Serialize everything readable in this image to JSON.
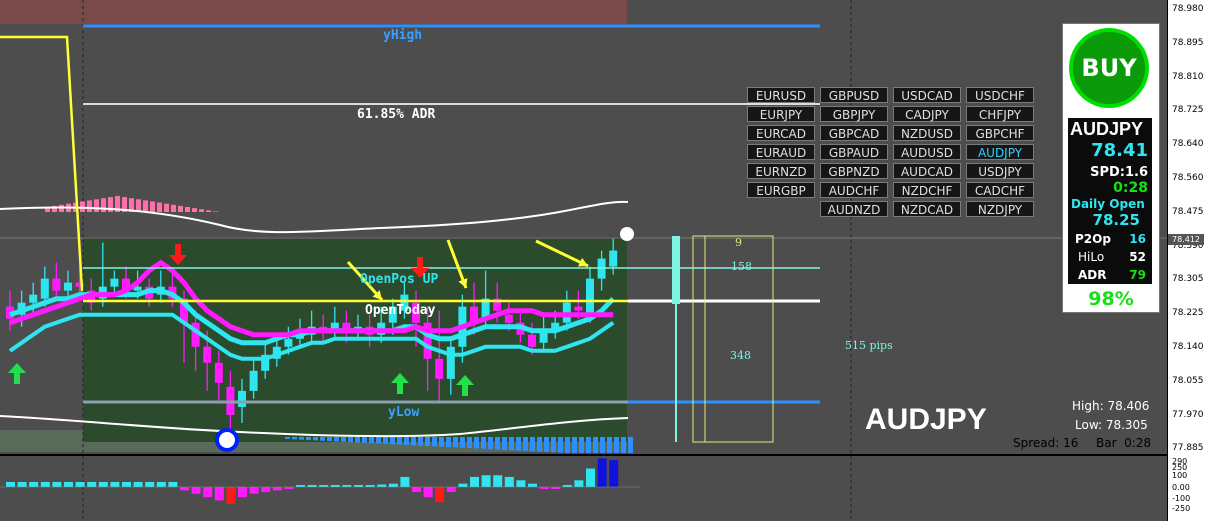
{
  "symbol": "AUDJPY",
  "chart_labels": {
    "y_high": "yHigh",
    "y_low": "yLow",
    "adr_line": "61.85% ADR",
    "open_pos": "OpenPos UP",
    "open_today": "OpenToday",
    "range_top": "9",
    "range_mid": "158",
    "range_bot": "348",
    "range_pips": "515 pips"
  },
  "price_axis": {
    "ticks": [
      "78.980",
      "78.895",
      "78.810",
      "78.725",
      "78.640",
      "78.560",
      "78.475",
      "78.390",
      "78.305",
      "78.225",
      "78.140",
      "78.055",
      "77.970",
      "77.885"
    ],
    "current_price": "78.412"
  },
  "indicator_axis": {
    "ticks": [
      "290",
      "250",
      "100",
      "0.00",
      "-100",
      "-250"
    ]
  },
  "pairs": [
    [
      "EURUSD",
      "GBPUSD",
      "USDCAD",
      "USDCHF"
    ],
    [
      "EURJPY",
      "GBPJPY",
      "CADJPY",
      "CHFJPY"
    ],
    [
      "EURCAD",
      "GBPCAD",
      "NZDUSD",
      "GBPCHF"
    ],
    [
      "EURAUD",
      "GBPAUD",
      "AUDUSD",
      "AUDJPY"
    ],
    [
      "EURNZD",
      "GBPNZD",
      "AUDCAD",
      "USDJPY"
    ],
    [
      "EURGBP",
      "AUDCHF",
      "NZDCHF",
      "CADCHF"
    ],
    [
      "",
      "AUDNZD",
      "NZDCAD",
      "NZDJPY"
    ]
  ],
  "active_pair": "AUDJPY",
  "panel": {
    "signal": "BUY",
    "symbol": "AUDJPY",
    "price": "78.41",
    "spread": "SPD:1.6",
    "timer": "0:28",
    "daily_open_label": "Daily Open",
    "daily_open": "78.25",
    "p2op_label": "P2Op",
    "p2op": "16",
    "hilo_label": "HiLo",
    "hilo": "52",
    "adr_label": "ADR",
    "adr": "79",
    "percent": "98%"
  },
  "bottom_info": {
    "symbol": "AUDJPY",
    "high": "High: 78.406",
    "low": "Low: 78.305",
    "spread": "Spread: 16",
    "bar": "Bar  0:28"
  },
  "colors": {
    "bull": "#2fe6f0",
    "bear": "#ff1aff",
    "green_arrow": "#22e04a",
    "red_arrow": "#ff1a1a",
    "yellow": "#ffff33",
    "blue_line": "#2f8fff",
    "pink_hist": "#ff6fa8",
    "range_box": "#2a4a2a"
  },
  "chart_data": {
    "type": "candlestick",
    "candles": [
      {
        "o": 78.24,
        "c": 78.21,
        "h": 78.28,
        "l": 78.18
      },
      {
        "o": 78.22,
        "c": 78.25,
        "h": 78.28,
        "l": 78.19
      },
      {
        "o": 78.25,
        "c": 78.27,
        "h": 78.3,
        "l": 78.22
      },
      {
        "o": 78.26,
        "c": 78.31,
        "h": 78.34,
        "l": 78.24
      },
      {
        "o": 78.31,
        "c": 78.28,
        "h": 78.35,
        "l": 78.26
      },
      {
        "o": 78.28,
        "c": 78.3,
        "h": 78.33,
        "l": 78.26
      },
      {
        "o": 78.3,
        "c": 78.29,
        "h": 78.34,
        "l": 78.27
      },
      {
        "o": 78.28,
        "c": 78.25,
        "h": 78.31,
        "l": 78.23
      },
      {
        "o": 78.26,
        "c": 78.29,
        "h": 78.4,
        "l": 78.24
      },
      {
        "o": 78.29,
        "c": 78.31,
        "h": 78.33,
        "l": 78.27
      },
      {
        "o": 78.31,
        "c": 78.28,
        "h": 78.34,
        "l": 78.26
      },
      {
        "o": 78.28,
        "c": 78.29,
        "h": 78.33,
        "l": 78.26
      },
      {
        "o": 78.29,
        "c": 78.26,
        "h": 78.31,
        "l": 78.24
      },
      {
        "o": 78.27,
        "c": 78.29,
        "h": 78.33,
        "l": 78.25
      },
      {
        "o": 78.29,
        "c": 78.26,
        "h": 78.33,
        "l": 78.24
      },
      {
        "o": 78.26,
        "c": 78.2,
        "h": 78.28,
        "l": 78.1
      },
      {
        "o": 78.2,
        "c": 78.14,
        "h": 78.23,
        "l": 78.08
      },
      {
        "o": 78.14,
        "c": 78.1,
        "h": 78.18,
        "l": 78.03
      },
      {
        "o": 78.1,
        "c": 78.05,
        "h": 78.13,
        "l": 78.0
      },
      {
        "o": 78.04,
        "c": 77.97,
        "h": 78.08,
        "l": 77.92
      },
      {
        "o": 77.99,
        "c": 78.03,
        "h": 78.06,
        "l": 77.95
      },
      {
        "o": 78.03,
        "c": 78.08,
        "h": 78.11,
        "l": 78.01
      },
      {
        "o": 78.08,
        "c": 78.12,
        "h": 78.15,
        "l": 78.06
      },
      {
        "o": 78.11,
        "c": 78.14,
        "h": 78.17,
        "l": 78.09
      },
      {
        "o": 78.14,
        "c": 78.16,
        "h": 78.19,
        "l": 78.12
      },
      {
        "o": 78.16,
        "c": 78.18,
        "h": 78.21,
        "l": 78.14
      },
      {
        "o": 78.17,
        "c": 78.19,
        "h": 78.23,
        "l": 78.15
      },
      {
        "o": 78.19,
        "c": 78.18,
        "h": 78.22,
        "l": 78.15
      },
      {
        "o": 78.18,
        "c": 78.2,
        "h": 78.24,
        "l": 78.16
      },
      {
        "o": 78.2,
        "c": 78.18,
        "h": 78.23,
        "l": 78.15
      },
      {
        "o": 78.18,
        "c": 78.19,
        "h": 78.22,
        "l": 78.16
      },
      {
        "o": 78.19,
        "c": 78.17,
        "h": 78.22,
        "l": 78.14
      },
      {
        "o": 78.17,
        "c": 78.2,
        "h": 78.24,
        "l": 78.15
      },
      {
        "o": 78.2,
        "c": 78.24,
        "h": 78.26,
        "l": 78.17
      },
      {
        "o": 78.23,
        "c": 78.27,
        "h": 78.3,
        "l": 78.21
      },
      {
        "o": 78.25,
        "c": 78.2,
        "h": 78.28,
        "l": 78.14
      },
      {
        "o": 78.2,
        "c": 78.11,
        "h": 78.24,
        "l": 78.03
      },
      {
        "o": 78.11,
        "c": 78.06,
        "h": 78.23,
        "l": 78.0
      },
      {
        "o": 78.06,
        "c": 78.14,
        "h": 78.16,
        "l": 78.02
      },
      {
        "o": 78.14,
        "c": 78.24,
        "h": 78.27,
        "l": 78.1
      },
      {
        "o": 78.24,
        "c": 78.2,
        "h": 78.3,
        "l": 78.17
      },
      {
        "o": 78.21,
        "c": 78.26,
        "h": 78.33,
        "l": 78.19
      },
      {
        "o": 78.26,
        "c": 78.23,
        "h": 78.3,
        "l": 78.2
      },
      {
        "o": 78.22,
        "c": 78.2,
        "h": 78.25,
        "l": 78.18
      },
      {
        "o": 78.2,
        "c": 78.17,
        "h": 78.23,
        "l": 78.15
      },
      {
        "o": 78.17,
        "c": 78.14,
        "h": 78.2,
        "l": 78.12
      },
      {
        "o": 78.15,
        "c": 78.18,
        "h": 78.22,
        "l": 78.13
      },
      {
        "o": 78.18,
        "c": 78.2,
        "h": 78.23,
        "l": 78.16
      },
      {
        "o": 78.2,
        "c": 78.25,
        "h": 78.28,
        "l": 78.18
      },
      {
        "o": 78.24,
        "c": 78.23,
        "h": 78.28,
        "l": 78.21
      },
      {
        "o": 78.22,
        "c": 78.31,
        "h": 78.34,
        "l": 78.2
      },
      {
        "o": 78.31,
        "c": 78.36,
        "h": 78.38,
        "l": 78.28
      },
      {
        "o": 78.34,
        "c": 78.38,
        "h": 78.41,
        "l": 78.32
      }
    ],
    "ma_fast": [
      78.22,
      78.23,
      78.24,
      78.25,
      78.26,
      78.26,
      78.27,
      78.27,
      78.27,
      78.27,
      78.27,
      78.27,
      78.28,
      78.28,
      78.27,
      78.25,
      78.22,
      78.2,
      78.18,
      78.16,
      78.15,
      78.15,
      78.15,
      78.16,
      78.17,
      78.17,
      78.18,
      78.18,
      78.18,
      78.18,
      78.18,
      78.18,
      78.18,
      78.18,
      78.19,
      78.19,
      78.17,
      78.16,
      78.16,
      78.17,
      78.18,
      78.19,
      78.19,
      78.19,
      78.19,
      78.18,
      78.18,
      78.18,
      78.19,
      78.2,
      78.21,
      78.23,
      78.26
    ],
    "ma_slow": [
      78.13,
      78.15,
      78.17,
      78.19,
      78.2,
      78.21,
      78.22,
      78.22,
      78.22,
      78.22,
      78.22,
      78.22,
      78.22,
      78.22,
      78.22,
      78.2,
      78.18,
      78.16,
      78.14,
      78.12,
      78.11,
      78.11,
      78.11,
      78.12,
      78.13,
      78.14,
      78.15,
      78.15,
      78.16,
      78.16,
      78.16,
      78.16,
      78.16,
      78.16,
      78.16,
      78.16,
      78.14,
      78.13,
      78.12,
      78.12,
      78.13,
      78.14,
      78.14,
      78.14,
      78.14,
      78.13,
      78.13,
      78.13,
      78.14,
      78.15,
      78.16,
      78.18,
      78.2
    ],
    "ma_magenta": [
      78.2,
      78.21,
      78.22,
      78.23,
      78.24,
      78.25,
      78.26,
      78.27,
      78.27,
      78.27,
      78.28,
      78.3,
      78.33,
      78.35,
      78.33,
      78.3,
      78.26,
      78.23,
      78.21,
      78.19,
      78.18,
      78.17,
      78.17,
      78.17,
      78.17,
      78.18,
      78.18,
      78.18,
      78.18,
      78.18,
      78.18,
      78.18,
      78.18,
      78.18,
      78.18,
      78.19,
      78.18,
      78.18,
      78.18,
      78.19,
      78.2,
      78.21,
      78.22,
      78.23,
      78.23,
      78.23,
      78.22,
      78.22,
      78.22,
      78.22,
      78.22,
      78.22,
      78.22
    ],
    "indicator_histogram": [
      30,
      30,
      30,
      30,
      30,
      30,
      30,
      30,
      30,
      30,
      30,
      30,
      30,
      30,
      30,
      -20,
      -40,
      -60,
      -80,
      -100,
      -60,
      -40,
      -30,
      -20,
      -10,
      0,
      0,
      0,
      10,
      10,
      5,
      10,
      15,
      20,
      60,
      -30,
      -60,
      -90,
      -30,
      20,
      60,
      70,
      70,
      60,
      40,
      20,
      -10,
      -10,
      10,
      40,
      110,
      170,
      160
    ]
  }
}
